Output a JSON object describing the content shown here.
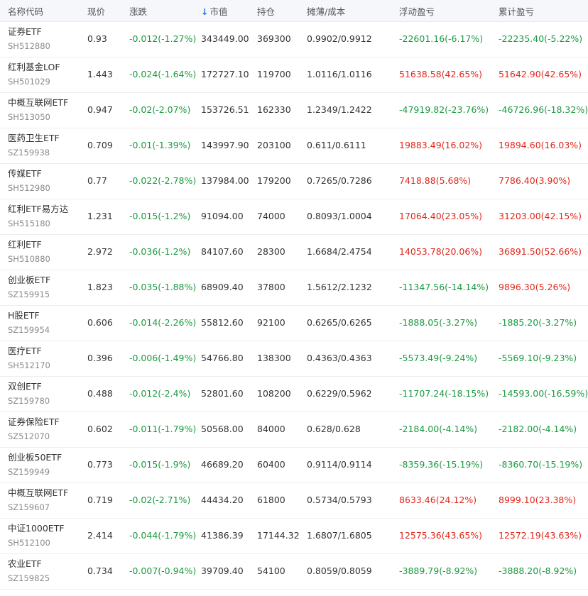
{
  "colors": {
    "gain": "#e0271b",
    "loss": "#1a9a3f",
    "sort_indicator": "#1e78d7"
  },
  "header": {
    "name": "名称代码",
    "price": "现价",
    "change": "涨跌",
    "sort_icon": "arrow-down-icon",
    "sort_glyph": "↓",
    "market_value": "市值",
    "qty": "持仓",
    "cost": "摊薄/成本",
    "float_pnl": "浮动盈亏",
    "acc_pnl": "累计盈亏"
  },
  "rows": [
    {
      "name": "证券ETF",
      "code": "SH512880",
      "price": "0.93",
      "change": "-0.012(-1.27%)",
      "mv": "343449.00",
      "qty": "369300",
      "cost": "0.9902/0.9912",
      "float": "-22601.16(-6.17%)",
      "acc": "-22235.40(-5.22%)"
    },
    {
      "name": "红利基金LOF",
      "code": "SH501029",
      "price": "1.443",
      "change": "-0.024(-1.64%)",
      "mv": "172727.10",
      "qty": "119700",
      "cost": "1.0116/1.0116",
      "float": "51638.58(42.65%)",
      "acc": "51642.90(42.65%)"
    },
    {
      "name": "中概互联网ETF",
      "code": "SH513050",
      "price": "0.947",
      "change": "-0.02(-2.07%)",
      "mv": "153726.51",
      "qty": "162330",
      "cost": "1.2349/1.2422",
      "float": "-47919.82(-23.76%)",
      "acc": "-46726.96(-18.32%)"
    },
    {
      "name": "医药卫生ETF",
      "code": "SZ159938",
      "price": "0.709",
      "change": "-0.01(-1.39%)",
      "mv": "143997.90",
      "qty": "203100",
      "cost": "0.611/0.6111",
      "float": "19883.49(16.02%)",
      "acc": "19894.60(16.03%)"
    },
    {
      "name": "传媒ETF",
      "code": "SH512980",
      "price": "0.77",
      "change": "-0.022(-2.78%)",
      "mv": "137984.00",
      "qty": "179200",
      "cost": "0.7265/0.7286",
      "float": "7418.88(5.68%)",
      "acc": "7786.40(3.90%)"
    },
    {
      "name": "红利ETF易方达",
      "code": "SH515180",
      "price": "1.231",
      "change": "-0.015(-1.2%)",
      "mv": "91094.00",
      "qty": "74000",
      "cost": "0.8093/1.0004",
      "float": "17064.40(23.05%)",
      "acc": "31203.00(42.15%)"
    },
    {
      "name": "红利ETF",
      "code": "SH510880",
      "price": "2.972",
      "change": "-0.036(-1.2%)",
      "mv": "84107.60",
      "qty": "28300",
      "cost": "1.6684/2.4754",
      "float": "14053.78(20.06%)",
      "acc": "36891.50(52.66%)"
    },
    {
      "name": "创业板ETF",
      "code": "SZ159915",
      "price": "1.823",
      "change": "-0.035(-1.88%)",
      "mv": "68909.40",
      "qty": "37800",
      "cost": "1.5612/2.1232",
      "float": "-11347.56(-14.14%)",
      "acc": "9896.30(5.26%)"
    },
    {
      "name": "H股ETF",
      "code": "SZ159954",
      "price": "0.606",
      "change": "-0.014(-2.26%)",
      "mv": "55812.60",
      "qty": "92100",
      "cost": "0.6265/0.6265",
      "float": "-1888.05(-3.27%)",
      "acc": "-1885.20(-3.27%)"
    },
    {
      "name": "医疗ETF",
      "code": "SH512170",
      "price": "0.396",
      "change": "-0.006(-1.49%)",
      "mv": "54766.80",
      "qty": "138300",
      "cost": "0.4363/0.4363",
      "float": "-5573.49(-9.24%)",
      "acc": "-5569.10(-9.23%)"
    },
    {
      "name": "双创ETF",
      "code": "SZ159780",
      "price": "0.488",
      "change": "-0.012(-2.4%)",
      "mv": "52801.60",
      "qty": "108200",
      "cost": "0.6229/0.5962",
      "float": "-11707.24(-18.15%)",
      "acc": "-14593.00(-16.59%)"
    },
    {
      "name": "证券保险ETF",
      "code": "SZ512070",
      "price": "0.602",
      "change": "-0.011(-1.79%)",
      "mv": "50568.00",
      "qty": "84000",
      "cost": "0.628/0.628",
      "float": "-2184.00(-4.14%)",
      "acc": "-2182.00(-4.14%)"
    },
    {
      "name": "创业板50ETF",
      "code": "SZ159949",
      "price": "0.773",
      "change": "-0.015(-1.9%)",
      "mv": "46689.20",
      "qty": "60400",
      "cost": "0.9114/0.9114",
      "float": "-8359.36(-15.19%)",
      "acc": "-8360.70(-15.19%)"
    },
    {
      "name": "中概互联网ETF",
      "code": "SZ159607",
      "price": "0.719",
      "change": "-0.02(-2.71%)",
      "mv": "44434.20",
      "qty": "61800",
      "cost": "0.5734/0.5793",
      "float": "8633.46(24.12%)",
      "acc": "8999.10(23.38%)"
    },
    {
      "name": "中证1000ETF",
      "code": "SH512100",
      "price": "2.414",
      "change": "-0.044(-1.79%)",
      "mv": "41386.39",
      "qty": "17144.32",
      "cost": "1.6807/1.6805",
      "float": "12575.36(43.65%)",
      "acc": "12572.19(43.63%)"
    },
    {
      "name": "农业ETF",
      "code": "SZ159825",
      "price": "0.734",
      "change": "-0.007(-0.94%)",
      "mv": "39709.40",
      "qty": "54100",
      "cost": "0.8059/0.8059",
      "float": "-3889.79(-8.92%)",
      "acc": "-3888.20(-8.92%)"
    }
  ]
}
